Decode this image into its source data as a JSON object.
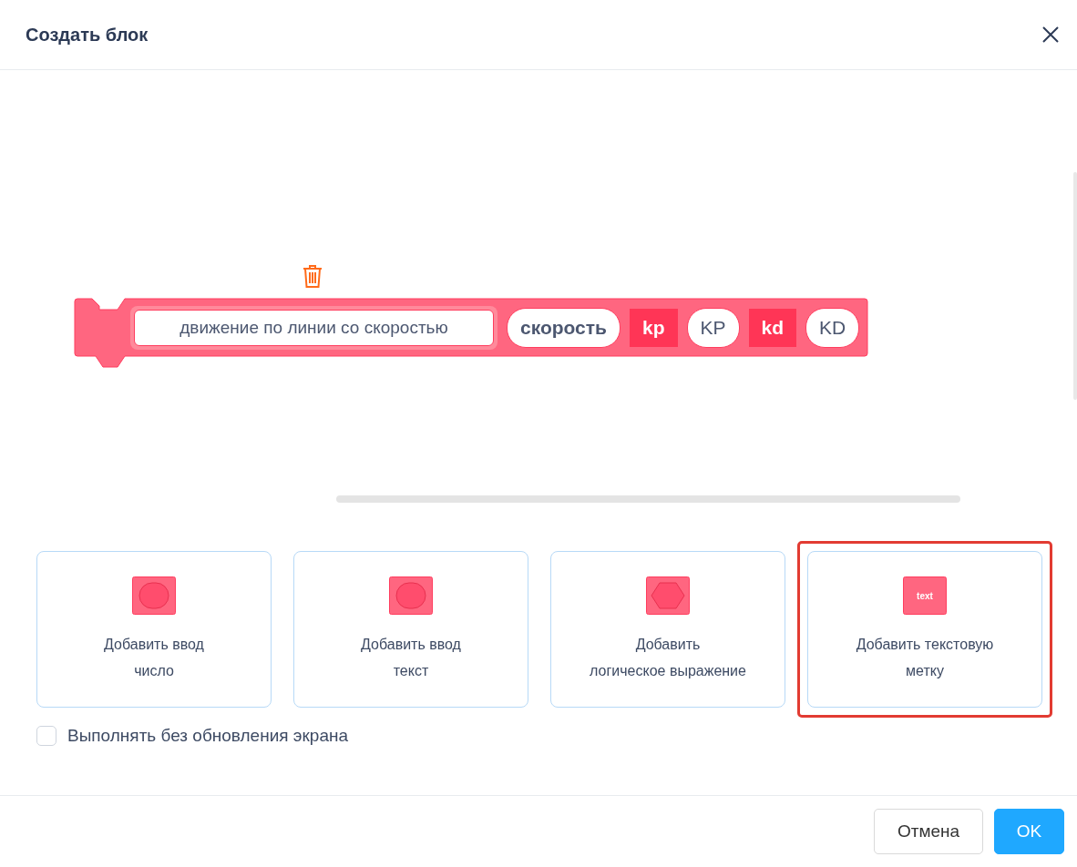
{
  "dialog": {
    "title": "Создать блок"
  },
  "block": {
    "parts": [
      {
        "kind": "field",
        "text": "движение по линии со скоростью"
      },
      {
        "kind": "input",
        "text": "скорость"
      },
      {
        "kind": "label",
        "text": "kp"
      },
      {
        "kind": "input",
        "text": "KP"
      },
      {
        "kind": "label",
        "text": "kd"
      },
      {
        "kind": "input",
        "text": "KD"
      }
    ]
  },
  "options": [
    {
      "kind": "number",
      "lines": [
        "Добавить ввод",
        "число"
      ],
      "selected": false
    },
    {
      "kind": "text",
      "lines": [
        "Добавить ввод",
        "текст"
      ],
      "selected": false
    },
    {
      "kind": "boolean",
      "lines": [
        "Добавить",
        "логическое выражение"
      ],
      "selected": false
    },
    {
      "kind": "label",
      "icon_text": "text",
      "lines": [
        "Добавить текстовую",
        "метку"
      ],
      "selected": true
    }
  ],
  "run_without_refresh": {
    "label": "Выполнять без обновления экрана",
    "checked": false
  },
  "buttons": [
    {
      "kind": "secondary",
      "label": "Отмена"
    },
    {
      "kind": "primary",
      "label": "OK"
    }
  ]
}
